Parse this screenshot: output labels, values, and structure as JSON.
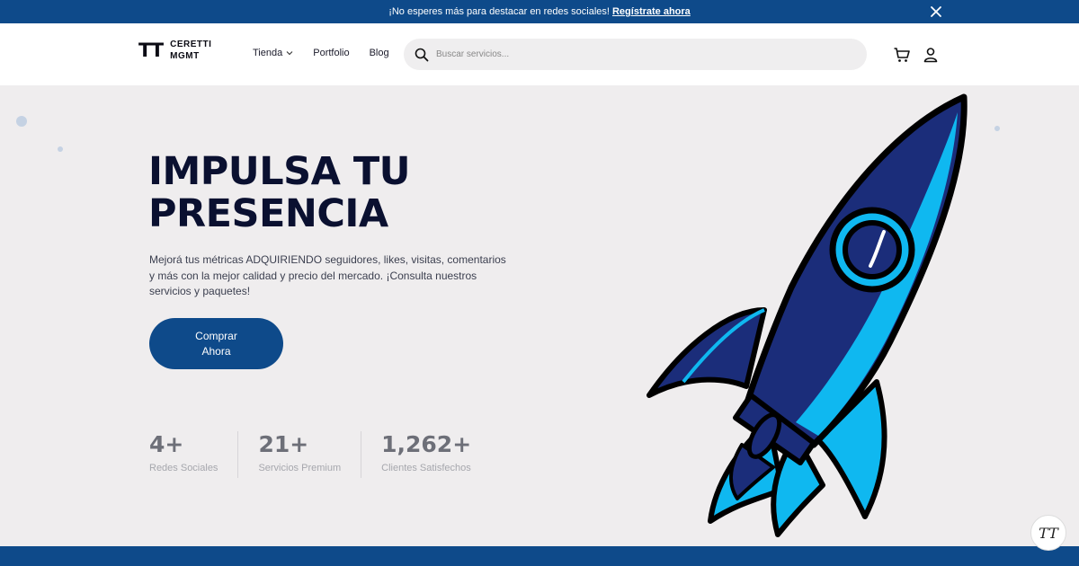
{
  "announcement": {
    "text": "¡No esperes más para destacar en redes sociales!",
    "link": "Regístrate ahora",
    "close_icon": "close-icon"
  },
  "header": {
    "logo_mark": "TT",
    "logo_line1": "CERETTI",
    "logo_line2": "MGMT",
    "nav": {
      "tienda": "Tienda",
      "portfolio": "Portfolio",
      "blog": "Blog"
    },
    "search_placeholder": "Buscar servicios...",
    "cart_icon": "cart-icon",
    "user_icon": "user-icon"
  },
  "hero": {
    "title_line1": "IMPULSA TU",
    "title_line2": "PRESENCIA",
    "description": "Mejorá tus métricas ADQUIRIENDO seguidores, likes, visitas, comentarios y más con la mejor calidad y precio del mercado. ¡Consulta nuestros servicios y paquetes!",
    "cta_line1": "Comprar",
    "cta_line2": "Ahora",
    "illustration": "rocket-illustration"
  },
  "stats": [
    {
      "value": "4+",
      "label": "Redes Sociales"
    },
    {
      "value": "21+",
      "label": "Servicios Premium"
    },
    {
      "value": "1,262+",
      "label": "Clientes Satisfechos"
    }
  ],
  "colors": {
    "primary": "#0e4a8a",
    "background": "#efedee",
    "rocket_light": "#0fb8f0",
    "rocket_dark": "#1e3a8a"
  },
  "badge": {
    "text": "TT"
  }
}
